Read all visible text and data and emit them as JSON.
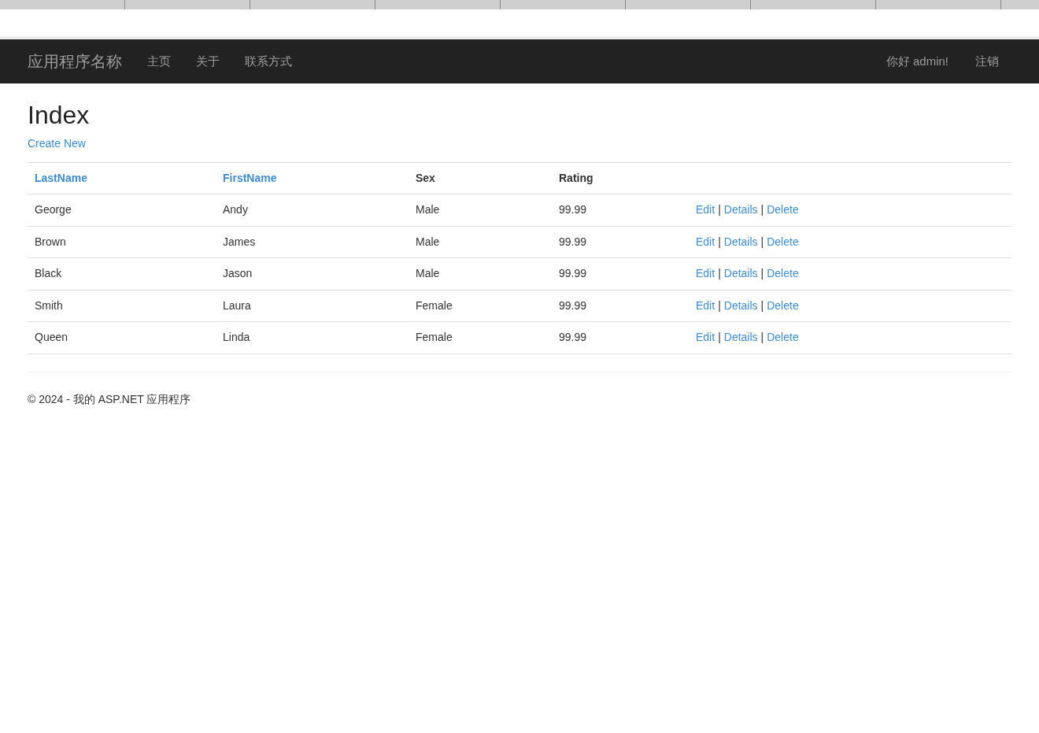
{
  "browser_tabs": [
    {
      "kind": "tab"
    },
    {
      "kind": "tab"
    },
    {
      "kind": "tab"
    },
    {
      "kind": "tab"
    },
    {
      "kind": "tab"
    },
    {
      "kind": "tab"
    },
    {
      "kind": "tab"
    },
    {
      "kind": "tab"
    }
  ],
  "navbar": {
    "brand": "应用程序名称",
    "links": [
      "主页",
      "关于",
      "联系方式"
    ],
    "greeting": "你好 admin!",
    "logout": "注销"
  },
  "page_title": "Index",
  "create_link": "Create New",
  "table": {
    "columns": [
      {
        "label": "LastName",
        "sortable": true
      },
      {
        "label": "FirstName",
        "sortable": true
      },
      {
        "label": "Sex",
        "sortable": false
      },
      {
        "label": "Rating",
        "sortable": false
      }
    ],
    "rows": [
      {
        "cells": [
          "George",
          "Andy",
          "Male",
          "99.99"
        ],
        "actions": [
          "Edit",
          "Details",
          "Delete"
        ],
        "separator": "|"
      },
      {
        "cells": [
          "Brown",
          "James",
          "Male",
          "99.99"
        ],
        "actions": [
          "Edit",
          "Details",
          "Delete"
        ],
        "separator": "|"
      },
      {
        "cells": [
          "Black",
          "Jason",
          "Male",
          "99.99"
        ],
        "actions": [
          "Edit",
          "Details",
          "Delete"
        ],
        "separator": "|"
      },
      {
        "cells": [
          "Smith",
          "Laura",
          "Female",
          "99.99"
        ],
        "actions": [
          "Edit",
          "Details",
          "Delete"
        ],
        "separator": "|"
      },
      {
        "cells": [
          "Queen",
          "Linda",
          "Female",
          "99.99"
        ],
        "actions": [
          "Edit",
          "Details",
          "Delete"
        ],
        "separator": "|"
      }
    ]
  },
  "footer": "© 2024 - 我的 ASP.NET 应用程序"
}
